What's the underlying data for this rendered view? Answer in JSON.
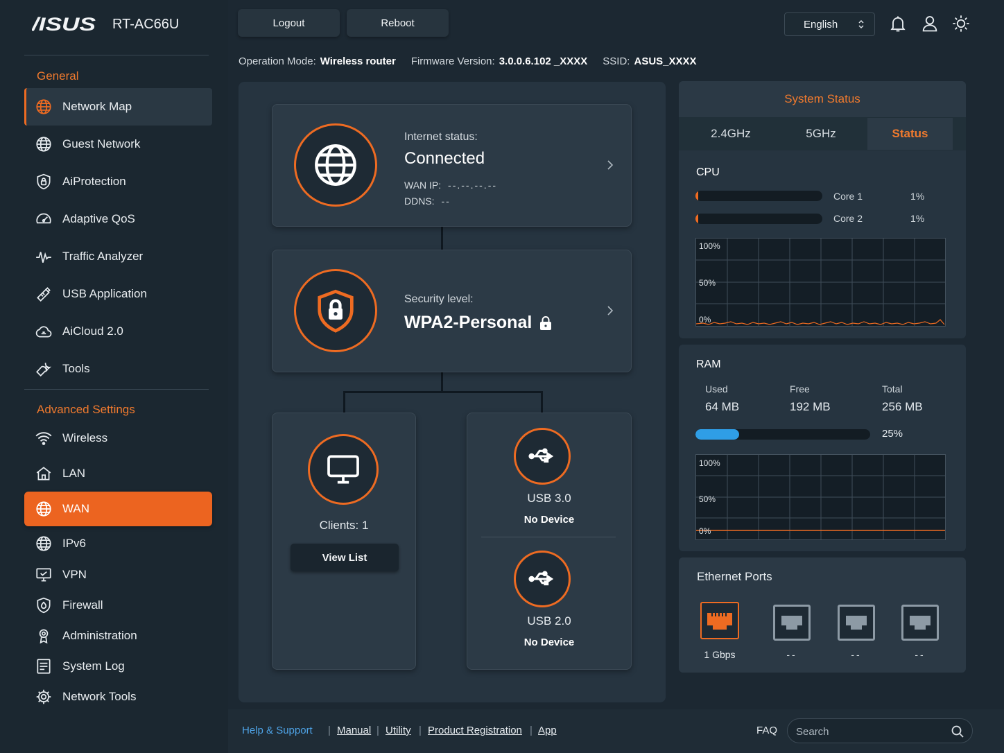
{
  "brand": {
    "logo": "/ISUS",
    "model": "RT-AC66U"
  },
  "colors": {
    "accent": "#ee6b22",
    "ram_bar": "#2f9ee6",
    "background": "#1c2832"
  },
  "sidebar": {
    "general_title": "General",
    "general_items": [
      {
        "label": "Network Map",
        "icon": "globe-icon"
      },
      {
        "label": "Guest Network",
        "icon": "guest-globe-icon"
      },
      {
        "label": "AiProtection",
        "icon": "shield-icon"
      },
      {
        "label": "Adaptive QoS",
        "icon": "gauge-icon"
      },
      {
        "label": "Traffic Analyzer",
        "icon": "pulse-icon"
      },
      {
        "label": "USB Application",
        "icon": "usb-icon"
      },
      {
        "label": "AiCloud 2.0",
        "icon": "cloud-icon"
      },
      {
        "label": "Tools",
        "icon": "wrench-icon"
      }
    ],
    "advanced_title": "Advanced Settings",
    "advanced_items": [
      {
        "label": "Wireless",
        "icon": "wifi-icon"
      },
      {
        "label": "LAN",
        "icon": "home-icon"
      },
      {
        "label": "WAN",
        "icon": "globe-icon"
      },
      {
        "label": "IPv6",
        "icon": "globe-icon"
      },
      {
        "label": "VPN",
        "icon": "monitor-icon"
      },
      {
        "label": "Firewall",
        "icon": "shield-icon"
      },
      {
        "label": "Administration",
        "icon": "admin-icon"
      },
      {
        "label": "System Log",
        "icon": "log-icon"
      },
      {
        "label": "Network Tools",
        "icon": "gear-icon"
      }
    ]
  },
  "header": {
    "logout_label": "Logout",
    "reboot_label": "Reboot",
    "language": "English"
  },
  "info": {
    "op_mode_label": "Operation Mode:",
    "op_mode_value": "Wireless router",
    "firmware_label": "Firmware Version:",
    "firmware_value": "3.0.0.6.102 _XXXX",
    "ssid_label": "SSID:",
    "ssid_value": "ASUS_XXXX"
  },
  "network_map": {
    "internet": {
      "status_label": "Internet status:",
      "status_value": "Connected",
      "wan_ip_label": "WAN IP:",
      "wan_ip_value": "--.--.--.--",
      "ddns_label": "DDNS:",
      "ddns_value": "--"
    },
    "security": {
      "label": "Security level:",
      "value": "WPA2-Personal"
    },
    "clients": {
      "label": "Clients: 1",
      "button": "View List"
    },
    "usb3": {
      "label": "USB 3.0",
      "status": "No Device"
    },
    "usb2": {
      "label": "USB 2.0",
      "status": "No Device"
    }
  },
  "system_status": {
    "title": "System Status",
    "tabs": [
      "2.4GHz",
      "5GHz",
      "Status"
    ],
    "active_tab": "Status",
    "cpu": {
      "title": "CPU",
      "cores": [
        {
          "label": "Core 1",
          "value": "1%",
          "fraction": 0.01
        },
        {
          "label": "Core 2",
          "value": "1%",
          "fraction": 0.01
        }
      ],
      "graph_labels": [
        "100%",
        "50%",
        "0%"
      ]
    },
    "ram": {
      "title": "RAM",
      "used_label": "Used",
      "used_value": "64 MB",
      "free_label": "Free",
      "free_value": "192 MB",
      "total_label": "Total",
      "total_value": "256 MB",
      "percent": "25%",
      "fraction": 0.25,
      "graph_labels": [
        "100%",
        "50%",
        "0%"
      ]
    },
    "ethernet": {
      "title": "Ethernet Ports",
      "ports": [
        {
          "label": "1 Gbps",
          "active": true
        },
        {
          "label": "--",
          "active": false
        },
        {
          "label": "--",
          "active": false
        },
        {
          "label": "--",
          "active": false
        }
      ]
    }
  },
  "footer": {
    "help": "Help & Support",
    "links": [
      "Manual",
      "Utility",
      "Product Registration",
      "App"
    ],
    "faq": "FAQ",
    "search_placeholder": "Search"
  }
}
